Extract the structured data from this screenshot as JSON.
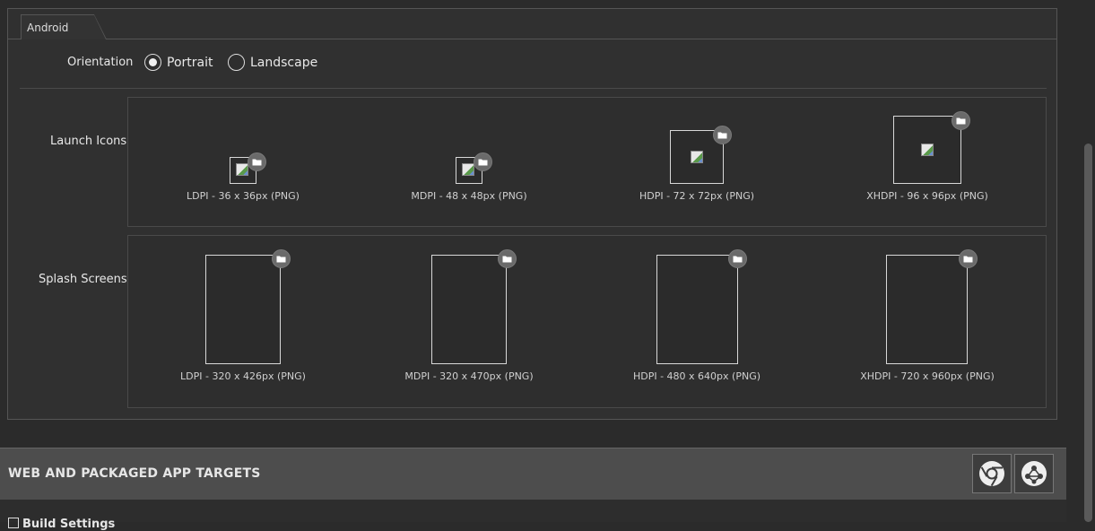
{
  "tab": {
    "label": "Android"
  },
  "orientation": {
    "label": "Orientation",
    "options": [
      {
        "label": "Portrait",
        "selected": true
      },
      {
        "label": "Landscape",
        "selected": false
      }
    ]
  },
  "launch_icons": {
    "label": "Launch Icons",
    "slots": [
      {
        "caption": "LDPI - 36 x 36px (PNG)"
      },
      {
        "caption": "MDPI - 48 x 48px (PNG)"
      },
      {
        "caption": "HDPI - 72 x 72px (PNG)"
      },
      {
        "caption": "XHDPI - 96 x 96px (PNG)"
      }
    ]
  },
  "splash_screens": {
    "label": "Splash Screens",
    "slots": [
      {
        "caption": "LDPI - 320 x 426px (PNG)"
      },
      {
        "caption": "MDPI - 320 x 470px (PNG)"
      },
      {
        "caption": "HDPI - 480 x 640px (PNG)"
      },
      {
        "caption": "XHDPI - 720 x 960px (PNG)"
      }
    ]
  },
  "web_targets": {
    "title": "WEB AND PACKAGED APP TARGETS",
    "buttons": [
      {
        "icon": "chrome-icon"
      },
      {
        "icon": "web-app-icon"
      }
    ]
  },
  "build_settings": {
    "label": "Build Settings"
  }
}
